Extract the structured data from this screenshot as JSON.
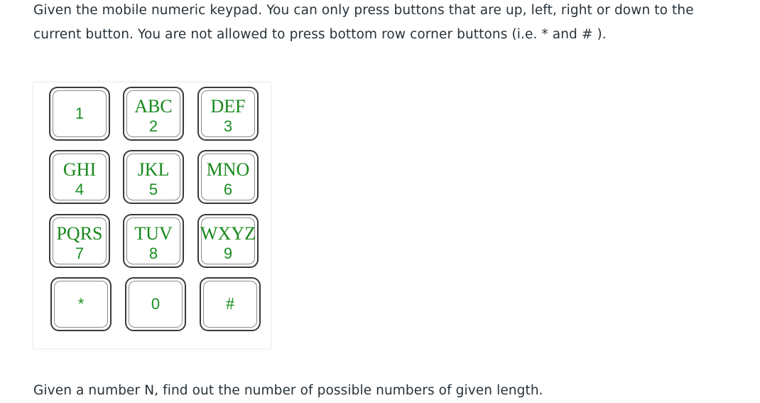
{
  "intro": "Given the mobile numeric keypad. You can only press buttons that are up, left, right or down to the current button. You are not allowed to press bottom row corner buttons (i.e. * and # ).",
  "question": "Given a number N, find out the number of possible numbers of given length.",
  "keypad": {
    "k1": {
      "letters": "",
      "digit": "1"
    },
    "k2": {
      "letters": "ABC",
      "digit": "2"
    },
    "k3": {
      "letters": "DEF",
      "digit": "3"
    },
    "k4": {
      "letters": "GHI",
      "digit": "4"
    },
    "k5": {
      "letters": "JKL",
      "digit": "5"
    },
    "k6": {
      "letters": "MNO",
      "digit": "6"
    },
    "k7": {
      "letters": "PQRS",
      "digit": "7"
    },
    "k8": {
      "letters": "TUV",
      "digit": "8"
    },
    "k9": {
      "letters": "WXYZ",
      "digit": "9"
    },
    "kstar": {
      "letters": "",
      "digit": "*"
    },
    "k0": {
      "letters": "",
      "digit": "0"
    },
    "khash": {
      "letters": "",
      "digit": "#"
    }
  },
  "colors": {
    "text": "#273239",
    "key_label": "#16881b",
    "key_border": "#3a3a3a"
  }
}
